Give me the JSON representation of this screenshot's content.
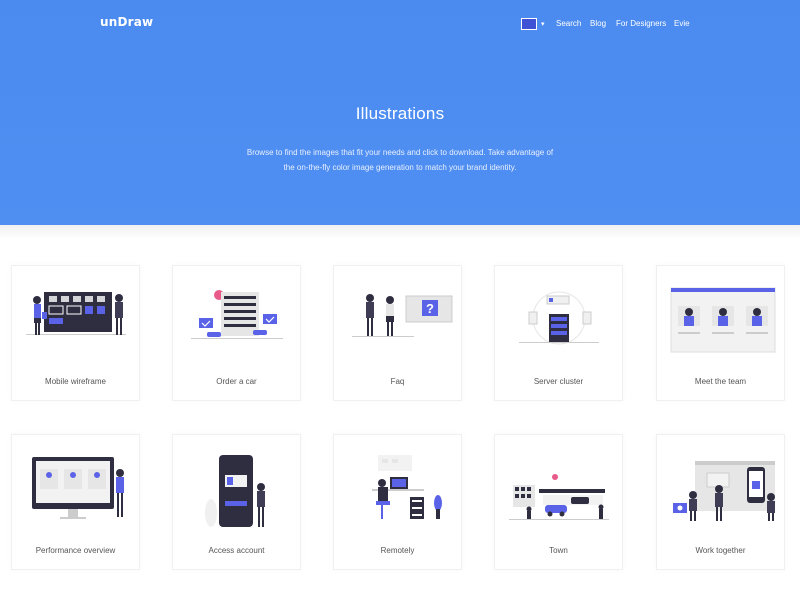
{
  "brand": {
    "logo": "unDraw"
  },
  "nav": {
    "color_picker_color": "#3f51d4",
    "color_picker_caret": "▾",
    "search": "Search",
    "blog": "Blog",
    "for_designers": "For Designers",
    "user": "Evie"
  },
  "hero": {
    "title": "Illustrations",
    "subtitle_line1": "Browse to find the images that fit your needs and click to download. Take advantage of",
    "subtitle_line2": "the on-the-fly color image generation to match your brand identity.",
    "background": "#4e8ef0"
  },
  "accent_color": "#5a63e8",
  "illustrations": [
    {
      "label": "Mobile wireframe",
      "icon": "mobile-wireframe-illustration"
    },
    {
      "label": "Order a car",
      "icon": "order-a-car-illustration"
    },
    {
      "label": "Faq",
      "icon": "faq-illustration"
    },
    {
      "label": "Server cluster",
      "icon": "server-cluster-illustration"
    },
    {
      "label": "Meet the team",
      "icon": "meet-the-team-illustration"
    },
    {
      "label": "Performance overview",
      "icon": "performance-overview-illustration"
    },
    {
      "label": "Access account",
      "icon": "access-account-illustration"
    },
    {
      "label": "Remotely",
      "icon": "remotely-illustration"
    },
    {
      "label": "Town",
      "icon": "town-illustration"
    },
    {
      "label": "Work together",
      "icon": "work-together-illustration"
    }
  ]
}
